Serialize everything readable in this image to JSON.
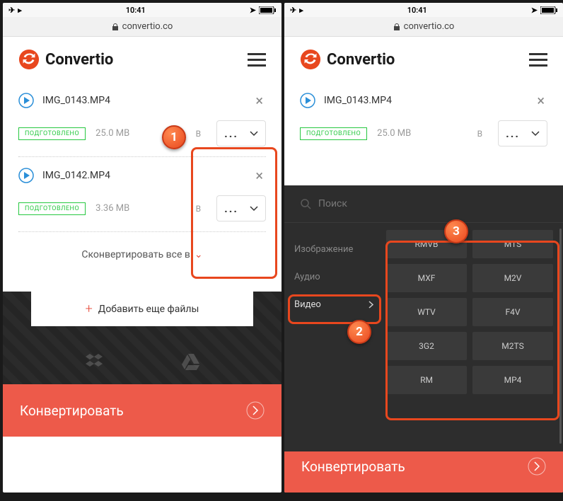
{
  "status": {
    "time": "10:41",
    "domain": "convertio.co"
  },
  "brand": "Convertio",
  "files": [
    {
      "name": "IMG_0143.MP4",
      "status": "ПОДГОТОВЛЕНО",
      "size": "25.0 MB",
      "to": "В",
      "fmt": "..."
    },
    {
      "name": "IMG_0142.MP4",
      "status": "ПОДГОТОВЛЕНО",
      "size": "3.36 MB",
      "to": "В",
      "fmt": "..."
    }
  ],
  "convertAll": "Сконвертировать все в",
  "addFiles": "Добавить еще файлы",
  "convertBtn": "Конвертировать",
  "picker": {
    "search": "Поиск",
    "categories": [
      "Изображение",
      "Аудио",
      "Видео"
    ],
    "formats": [
      "RMVB",
      "MTS",
      "MXF",
      "M2V",
      "WTV",
      "F4V",
      "3G2",
      "M2TS",
      "RM",
      "MP4"
    ]
  }
}
